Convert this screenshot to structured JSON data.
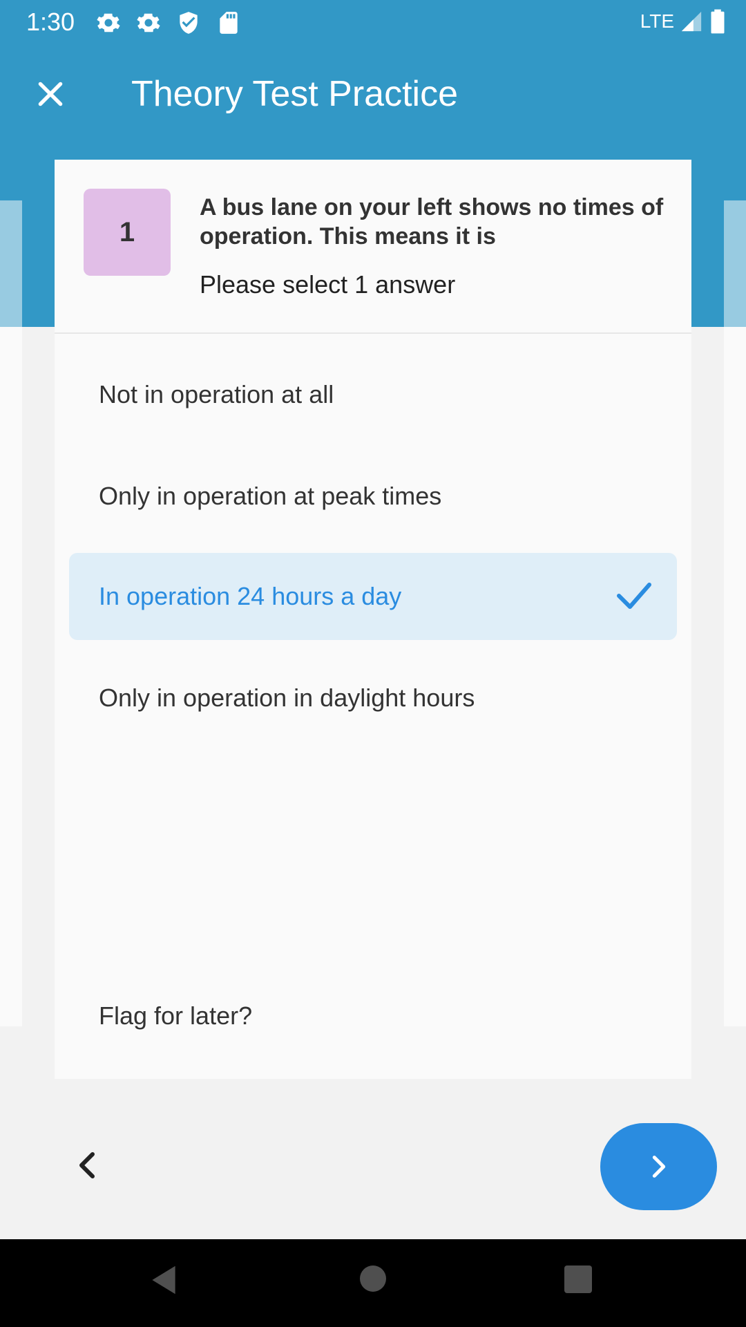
{
  "status_bar": {
    "time": "1:30",
    "network": "LTE",
    "icons": [
      "gear-icon",
      "gear-icon",
      "shield-icon",
      "sd-card-icon",
      "signal-icon",
      "battery-icon"
    ]
  },
  "app_bar": {
    "title": "Theory Test Practice",
    "close_icon": "close-icon"
  },
  "question": {
    "number": "1",
    "text": "A bus lane on your left shows no times of operation. This means it is",
    "instruction": "Please select 1 answer"
  },
  "answers": [
    {
      "label": "Not in operation at all",
      "selected": false
    },
    {
      "label": "Only in operation at peak times",
      "selected": false
    },
    {
      "label": "In operation 24 hours a day",
      "selected": true
    },
    {
      "label": "Only in operation in daylight hours",
      "selected": false
    }
  ],
  "flag": {
    "label": "Flag for later?"
  },
  "navigation": {
    "prev_icon": "chevron-left-icon",
    "next_icon": "chevron-right-icon"
  },
  "colors": {
    "primary": "#3298c6",
    "accent": "#2a8ce0",
    "selected_bg": "#dfeef8",
    "badge": "#e1bee7"
  }
}
